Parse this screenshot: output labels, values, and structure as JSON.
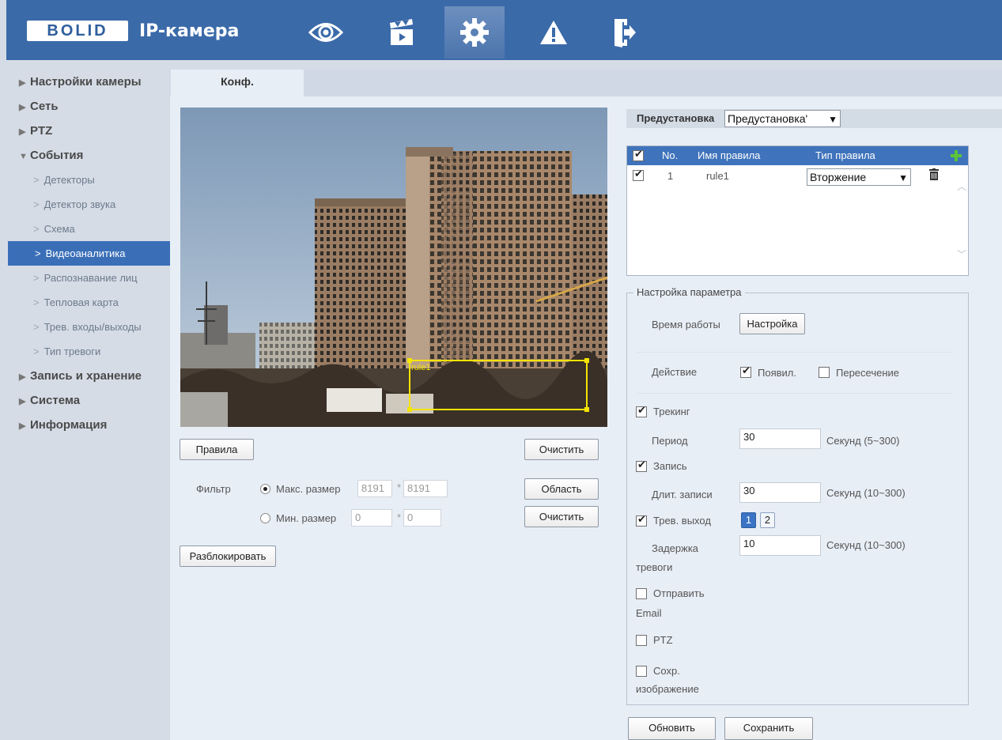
{
  "header": {
    "logo_text": "BOLID",
    "app_title": "IP-камера",
    "nav_icons": [
      "eye-icon",
      "clapperboard-icon",
      "gear-icon",
      "warning-icon",
      "logout-icon"
    ],
    "active_icon": "gear-icon"
  },
  "sidebar": {
    "items": [
      {
        "label": "Настройки камеры",
        "type": "section",
        "expanded": false
      },
      {
        "label": "Сеть",
        "type": "section",
        "expanded": false
      },
      {
        "label": "PTZ",
        "type": "section",
        "expanded": false
      },
      {
        "label": "События",
        "type": "section",
        "expanded": true
      },
      {
        "label": "Детекторы",
        "type": "sub"
      },
      {
        "label": "Детектор звука",
        "type": "sub"
      },
      {
        "label": "Схема",
        "type": "sub"
      },
      {
        "label": "Видеоаналитика",
        "type": "sub",
        "active": true
      },
      {
        "label": "Распознавание лиц",
        "type": "sub"
      },
      {
        "label": "Тепловая карта",
        "type": "sub"
      },
      {
        "label": "Трев. входы/выходы",
        "type": "sub"
      },
      {
        "label": "Тип тревоги",
        "type": "sub"
      },
      {
        "label": "Запись и хранение",
        "type": "section",
        "expanded": false
      },
      {
        "label": "Система",
        "type": "section",
        "expanded": false
      },
      {
        "label": "Информация",
        "type": "section",
        "expanded": false
      }
    ]
  },
  "tabs": [
    {
      "label": "Конф.",
      "active": true
    }
  ],
  "video": {
    "rule_label": "rule1"
  },
  "left_controls": {
    "rules_button": "Правила",
    "clear_button_1": "Очистить",
    "filter_label": "Фильтр",
    "max_size_label": "Макс. размер",
    "max_w": "8191",
    "max_h": "8191",
    "min_size_label": "Мин. размер",
    "min_w": "0",
    "min_h": "0",
    "times": "*",
    "area_button": "Область",
    "clear_button_2": "Очистить",
    "unlock_button": "Разблокировать"
  },
  "preset": {
    "label": "Предустановка",
    "value": "Предустановка'"
  },
  "rules_table": {
    "headers": {
      "no": "No.",
      "name": "Имя правила",
      "type": "Тип правила"
    },
    "rows": [
      {
        "checked": true,
        "no": "1",
        "name": "rule1",
        "type": "Вторжение"
      }
    ]
  },
  "params": {
    "legend": "Настройка параметра",
    "work_time_label": "Время работы",
    "work_time_button": "Настройка",
    "action_label": "Действие",
    "action_appear": "Появил.",
    "action_cross": "Пересечение",
    "tracking_label": "Трекинг",
    "period_label": "Период",
    "period_value": "30",
    "period_hint": "Секунд (5~300)",
    "record_label": "Запись",
    "record_len_label": "Длит. записи",
    "record_len_value": "30",
    "record_len_hint": "Секунд (10~300)",
    "alarm_out_label": "Трев. выход",
    "alarm_out_1": "1",
    "alarm_out_2": "2",
    "alarm_delay_label_1": "Задержка",
    "alarm_delay_label_2": "тревоги",
    "alarm_delay_value": "10",
    "alarm_delay_hint": "Секунд (10~300)",
    "send_email_1": "Отправить",
    "send_email_2": "Email",
    "ptz_label": "PTZ",
    "save_img_1": "Сохр.",
    "save_img_2": "изображение"
  },
  "footer": {
    "refresh_button": "Обновить",
    "save_button": "Сохранить"
  },
  "colors": {
    "header_bg": "#3b6aa9",
    "active_nav": "#3a6fb8",
    "table_head": "#3f73bb",
    "rule_box": "#f5e400"
  }
}
